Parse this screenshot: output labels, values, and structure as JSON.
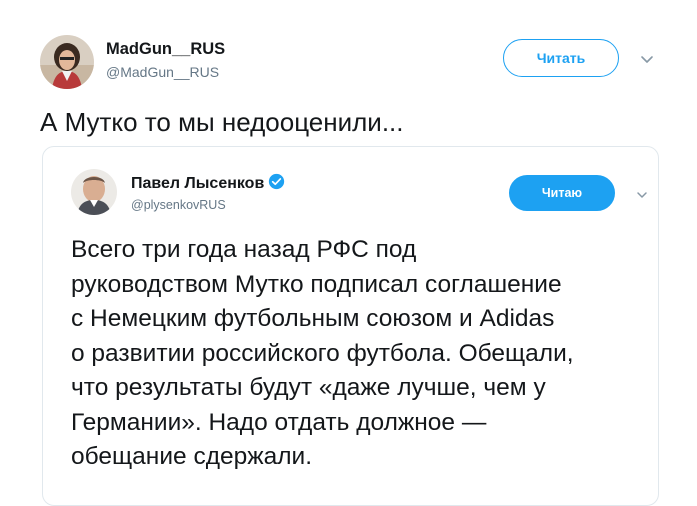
{
  "tweet": {
    "author": {
      "display_name": "MadGun__RUS",
      "handle": "@MadGun__RUS",
      "avatar_icon": "user-photo-avatar"
    },
    "follow_label": "Читать",
    "menu_icon": "chevron-down-icon",
    "text": "А Мутко то мы недооценили..."
  },
  "quoted_tweet": {
    "author": {
      "display_name": "Павел Лысенков",
      "handle": "@plysenkovRUS",
      "verified": true,
      "avatar_icon": "user-photo-avatar"
    },
    "follow_label": "Читаю",
    "menu_icon": "chevron-down-icon",
    "text_lines": [
      "Всего три года назад РФС под",
      "руководством Мутко подписал соглашение",
      "с Немецким футбольным союзом и Adidas",
      "о развитии российского футбола. Обещали,",
      "что результаты будут «даже лучше, чем у",
      "Германии». Надо отдать должное —",
      "обещание сдержали."
    ]
  },
  "colors": {
    "accent": "#1da1f2",
    "text": "#14171a",
    "secondary_text": "#657786",
    "border": "#e1e8ed"
  }
}
